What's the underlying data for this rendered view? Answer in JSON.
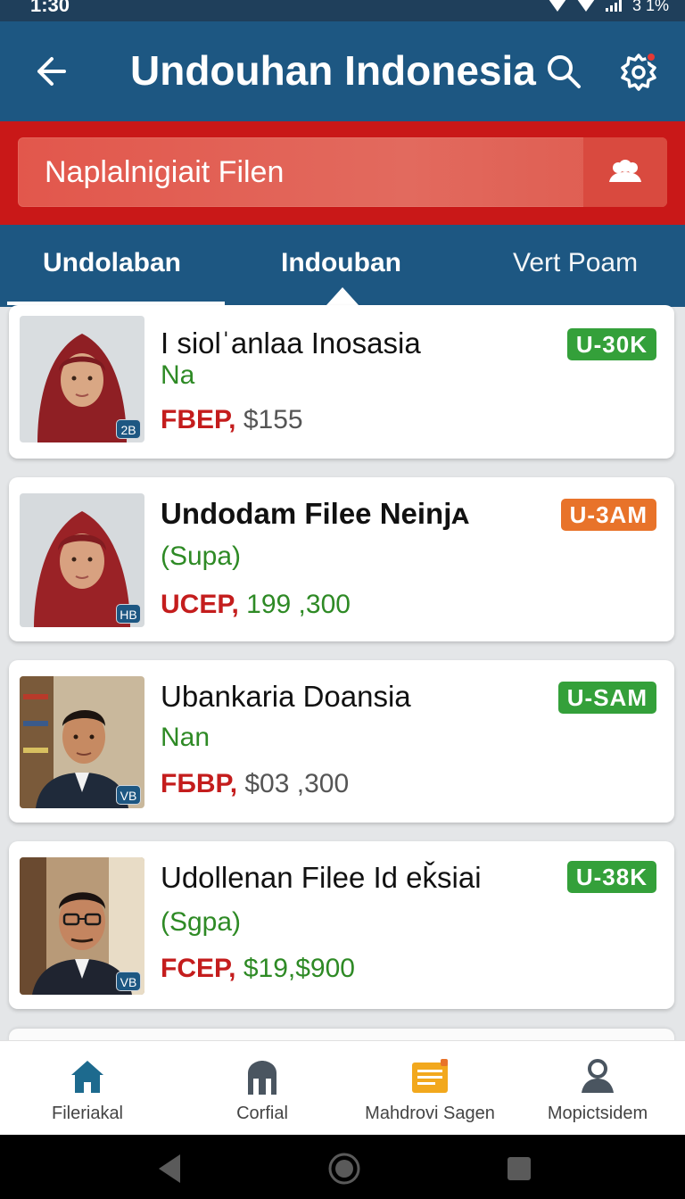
{
  "status_bar": {
    "time": "1:30",
    "battery": "3 1%"
  },
  "app_bar": {
    "title": "Undouhan Indonesia",
    "has_notification": true
  },
  "search": {
    "placeholder": "Naplalnigiait Filen"
  },
  "tabs": [
    {
      "label": "Undolaban",
      "active": true
    },
    {
      "label": "Indouban",
      "active": false
    },
    {
      "label": "Vert Poam",
      "active": false
    }
  ],
  "cards": [
    {
      "title": "I siolˈanlaa Inosasia",
      "subtitle": "Na",
      "price_code": "FBEP,",
      "price_amount": "$155",
      "amount_style": "gray",
      "tag": "U-30K",
      "tag_color": "green",
      "badge": "2B",
      "avatar": "woman-hijab"
    },
    {
      "title": "Undodam Filee Neinjᴀ",
      "subtitle": "(Supa)",
      "price_code": "UCEP,",
      "price_amount": "199 ,300",
      "amount_style": "green",
      "tag": "U-3AM",
      "tag_color": "orange",
      "badge": "HB",
      "avatar": "woman-hijab"
    },
    {
      "title": "Ubankaria Doansia",
      "subtitle": "Nan",
      "price_code": "FБBP,",
      "price_amount": "$03 ,300",
      "amount_style": "gray",
      "tag": "U-SAM",
      "tag_color": "green",
      "badge": "VB",
      "avatar": "man-suit"
    },
    {
      "title": "Udollenan Filee Id eǩsiai",
      "subtitle": "(Sgpa)",
      "price_code": "FCEP,",
      "price_amount": "$19,$900",
      "amount_style": "green",
      "tag": "U-38K",
      "tag_color": "green",
      "badge": "VB",
      "avatar": "man-glasses"
    }
  ],
  "bottom_nav": [
    {
      "label": "Fileriakal",
      "icon": "home-icon",
      "active": true
    },
    {
      "label": "Corfial",
      "icon": "building-icon",
      "active": false
    },
    {
      "label": "Mahdrovi Sagen",
      "icon": "document-icon",
      "active": false
    },
    {
      "label": "Mopictsidem",
      "icon": "person-icon",
      "active": false
    }
  ],
  "colors": {
    "app_bar": "#1d5782",
    "search_strip": "#c91818",
    "tag_green": "#34a03a",
    "tag_orange": "#e8732a",
    "price_red": "#c41d1d",
    "sub_green": "#2e8a25"
  }
}
